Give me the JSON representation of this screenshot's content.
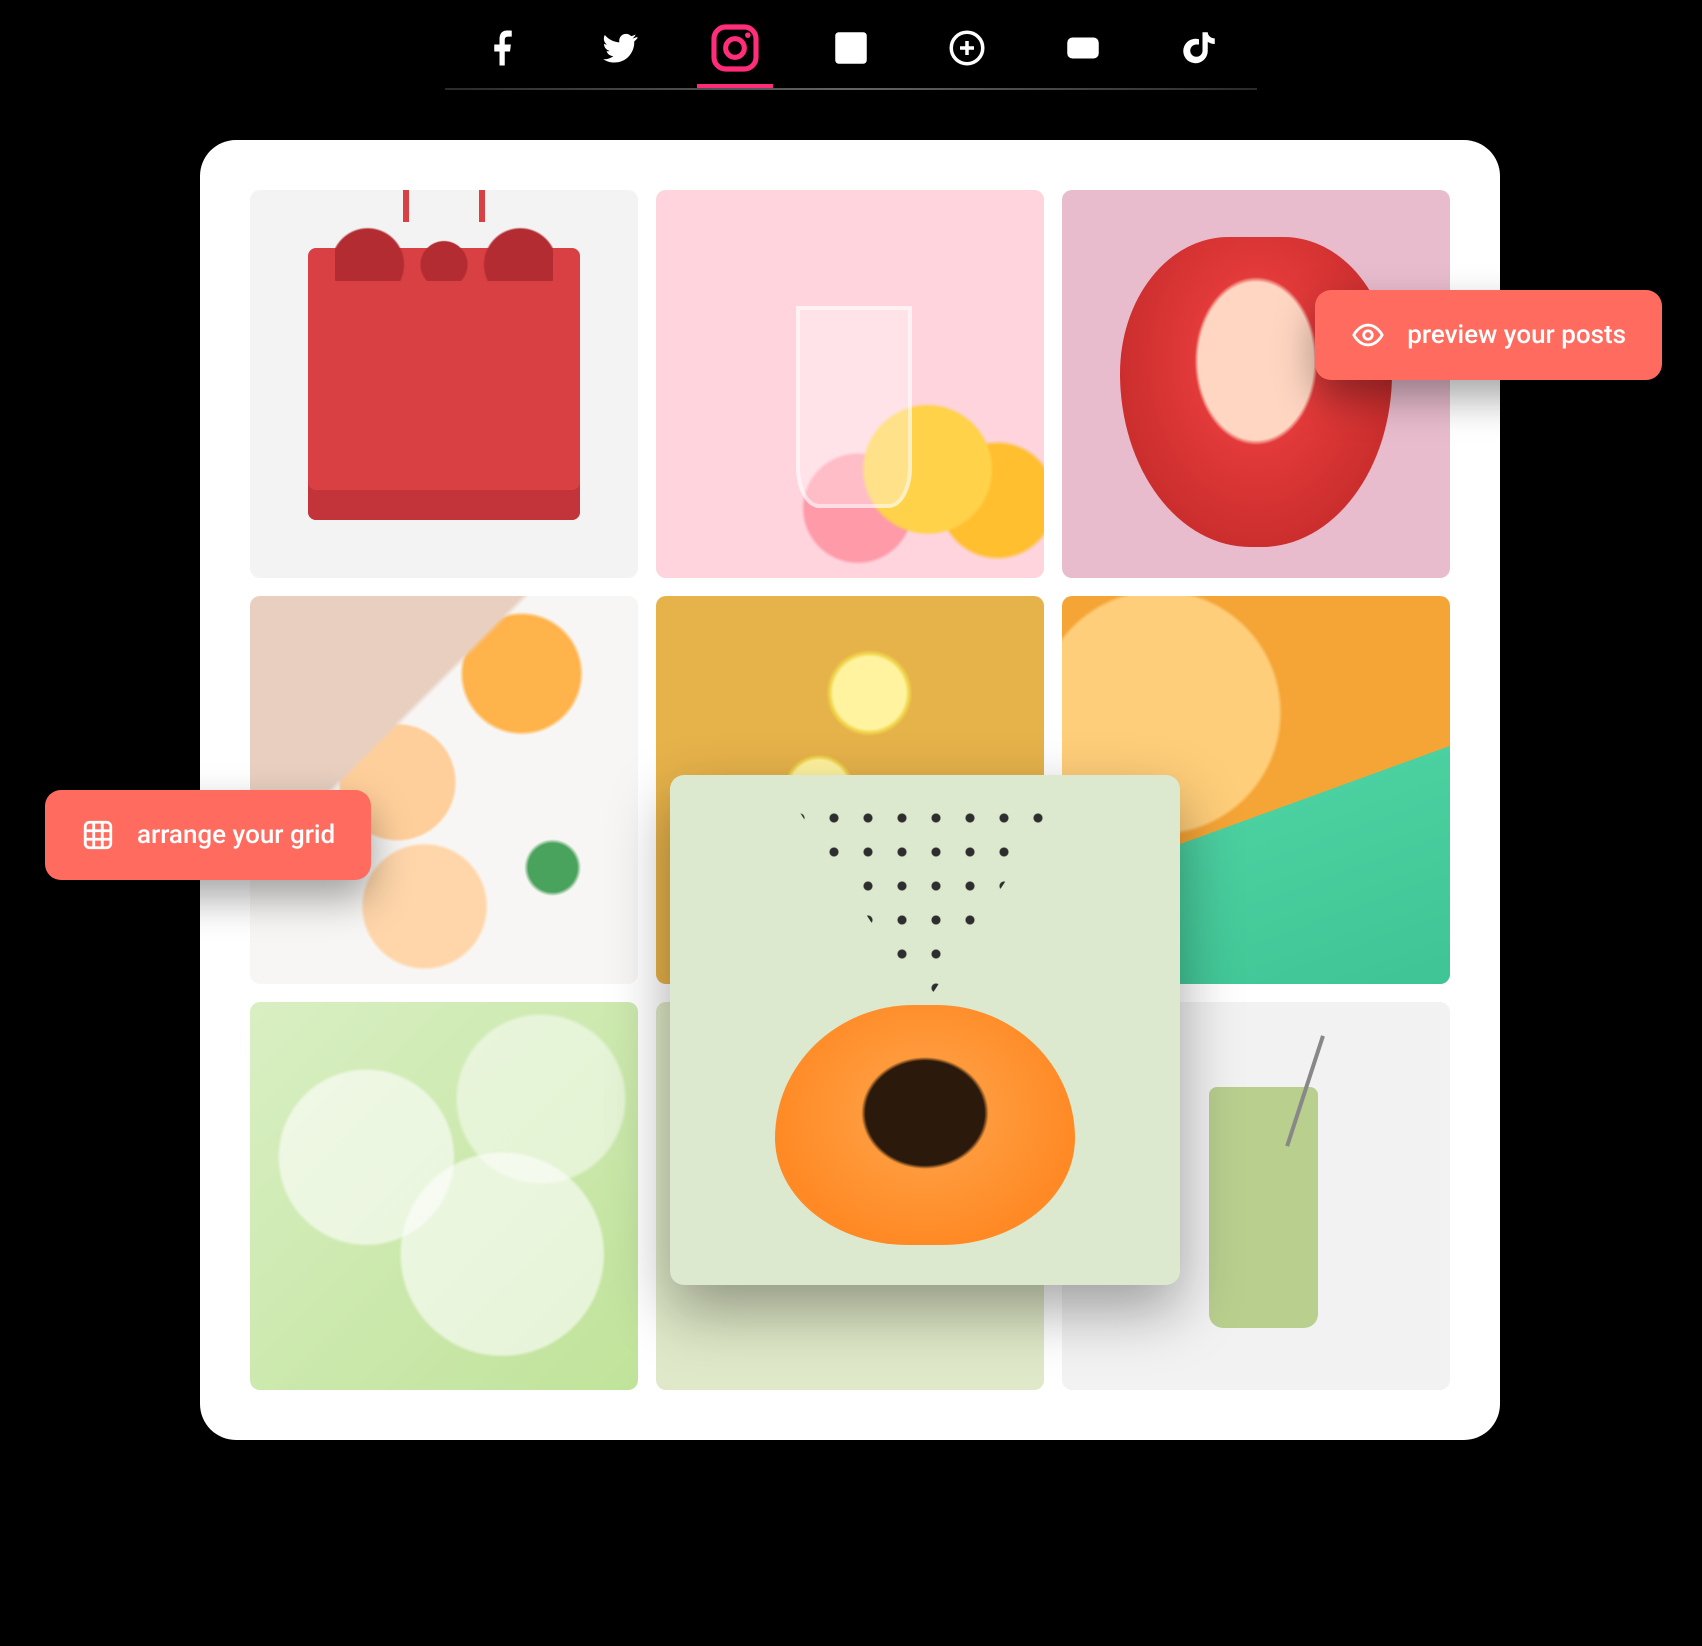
{
  "tabs": [
    {
      "name": "facebook",
      "active": false
    },
    {
      "name": "twitter",
      "active": false
    },
    {
      "name": "instagram",
      "active": true
    },
    {
      "name": "linkedin",
      "active": false
    },
    {
      "name": "google",
      "active": false
    },
    {
      "name": "youtube",
      "active": false
    },
    {
      "name": "tiktok",
      "active": false
    }
  ],
  "grid": {
    "tiles": [
      {
        "id": 1,
        "desc": "red juice 6-pack"
      },
      {
        "id": 2,
        "desc": "pink lemonade drink"
      },
      {
        "id": 3,
        "desc": "strawberry half"
      },
      {
        "id": 4,
        "desc": "grapefruit juices on cloth"
      },
      {
        "id": 5,
        "desc": "sliced lemons on yellow"
      },
      {
        "id": 6,
        "desc": "orange popsicle product"
      },
      {
        "id": 7,
        "desc": "lime slices"
      },
      {
        "id": 8,
        "desc": "papaya seeds art (being dragged)"
      },
      {
        "id": 9,
        "desc": "green smoothie glass"
      }
    ]
  },
  "callouts": {
    "arrange": "arrange your grid",
    "preview": "preview your posts"
  },
  "colors": {
    "accent": "#ff2d7a",
    "callout": "#ff6b5e"
  }
}
